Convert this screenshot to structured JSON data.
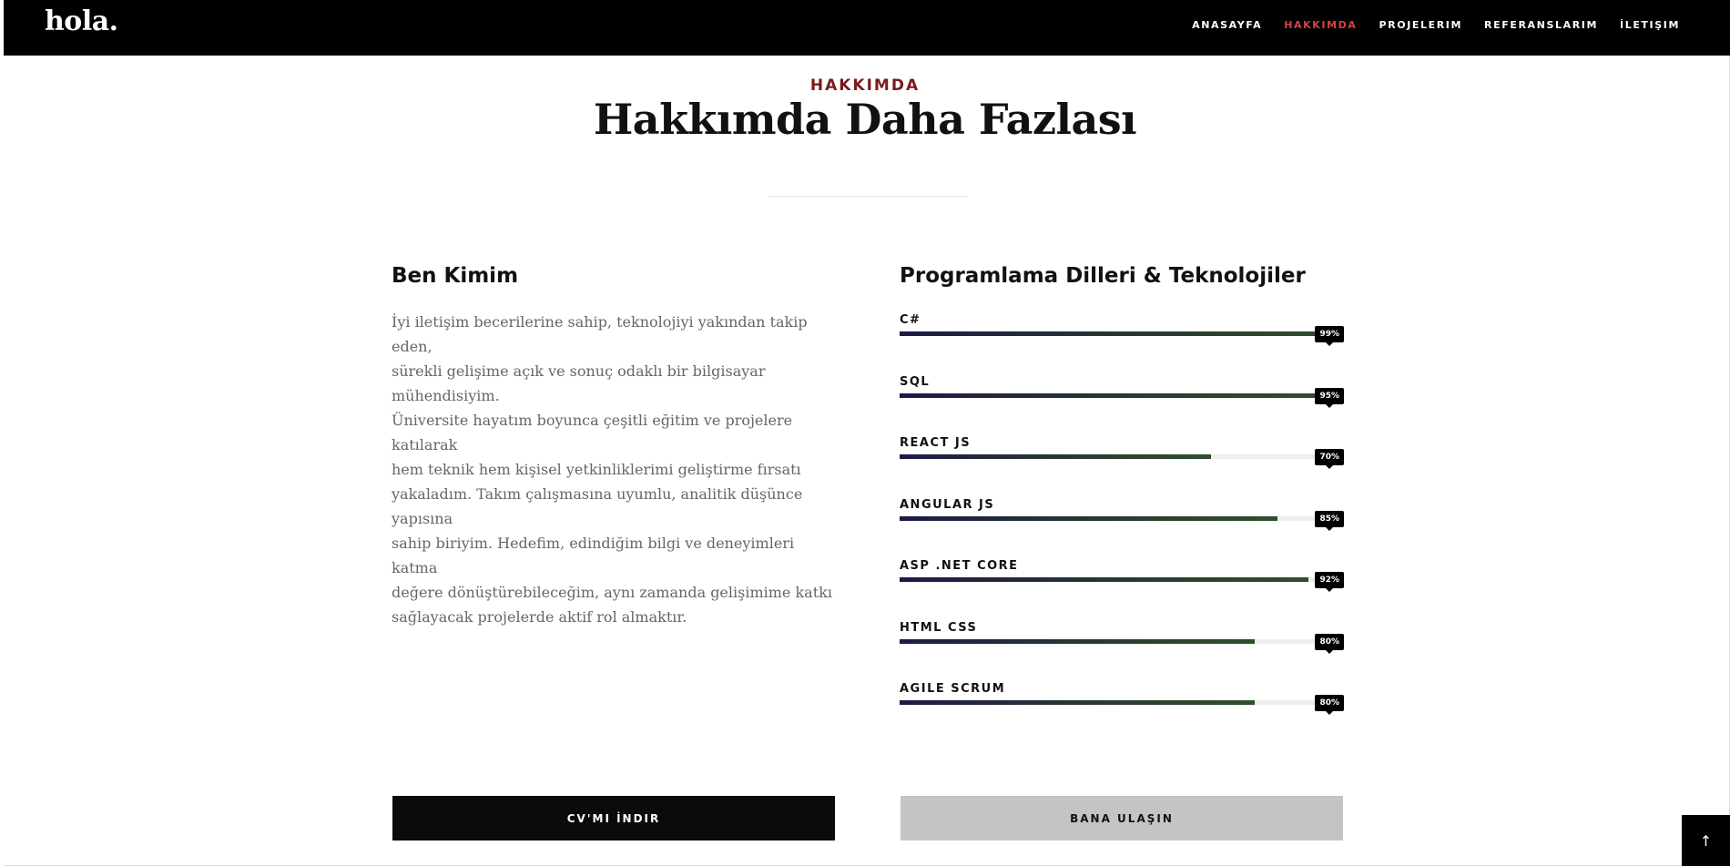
{
  "brand": {
    "logo_text": "hola."
  },
  "nav": {
    "items": [
      {
        "label": "ANASAYFA"
      },
      {
        "label": "HAKKIMDA",
        "active": true
      },
      {
        "label": "PROJELERIM"
      },
      {
        "label": "REFERANSLARIM"
      },
      {
        "label": "İLETIŞIM"
      }
    ]
  },
  "section": {
    "eyebrow": "HAKKIMDA",
    "title": "Hakkımda Daha Fazlası"
  },
  "about": {
    "heading": "Ben Kimim",
    "bio_lines": [
      "İyi iletişim becerilerine sahip, teknolojiyi yakından takip eden,",
      "sürekli gelişime açık ve sonuç odaklı bir bilgisayar mühendisiyim.",
      "Üniversite hayatım boyunca çeşitli eğitim ve projelere katılarak",
      "hem teknik hem kişisel yetkinliklerimi geliştirme fırsatı",
      "yakaladım. Takım çalışmasına uyumlu, analitik düşünce yapısına",
      "sahip biriyim. Hedefim, edindiğim bilgi ve deneyimleri katma",
      "değere dönüştürebileceğim, aynı zamanda gelişimime katkı",
      "sağlayacak projelerde aktif rol almaktır."
    ]
  },
  "skills": {
    "heading": "Programlama Dilleri & Teknolojiler",
    "items": [
      {
        "name": "C#",
        "percent": 99,
        "label": "99%"
      },
      {
        "name": "SQL",
        "percent": 95,
        "label": "95%"
      },
      {
        "name": "REACT JS",
        "percent": 70,
        "label": "70%"
      },
      {
        "name": "ANGULAR JS",
        "percent": 85,
        "label": "85%"
      },
      {
        "name": "ASP .NET CORE",
        "percent": 92,
        "label": "92%"
      },
      {
        "name": "HTML CSS",
        "percent": 80,
        "label": "80%"
      },
      {
        "name": "AGILE SCRUM",
        "percent": 80,
        "label": "80%"
      }
    ]
  },
  "buttons": {
    "cv_label": "CV'MI İNDIR",
    "contact_label": "BANA ULAŞIN"
  },
  "back_to_top": {
    "icon": "arrow-up-icon",
    "glyph": "↑"
  },
  "colors": {
    "nav_active": "#d64242",
    "eyebrow": "#7a1a1a",
    "bar_start": "#1b1b45",
    "bar_end": "#2f4f2c"
  }
}
